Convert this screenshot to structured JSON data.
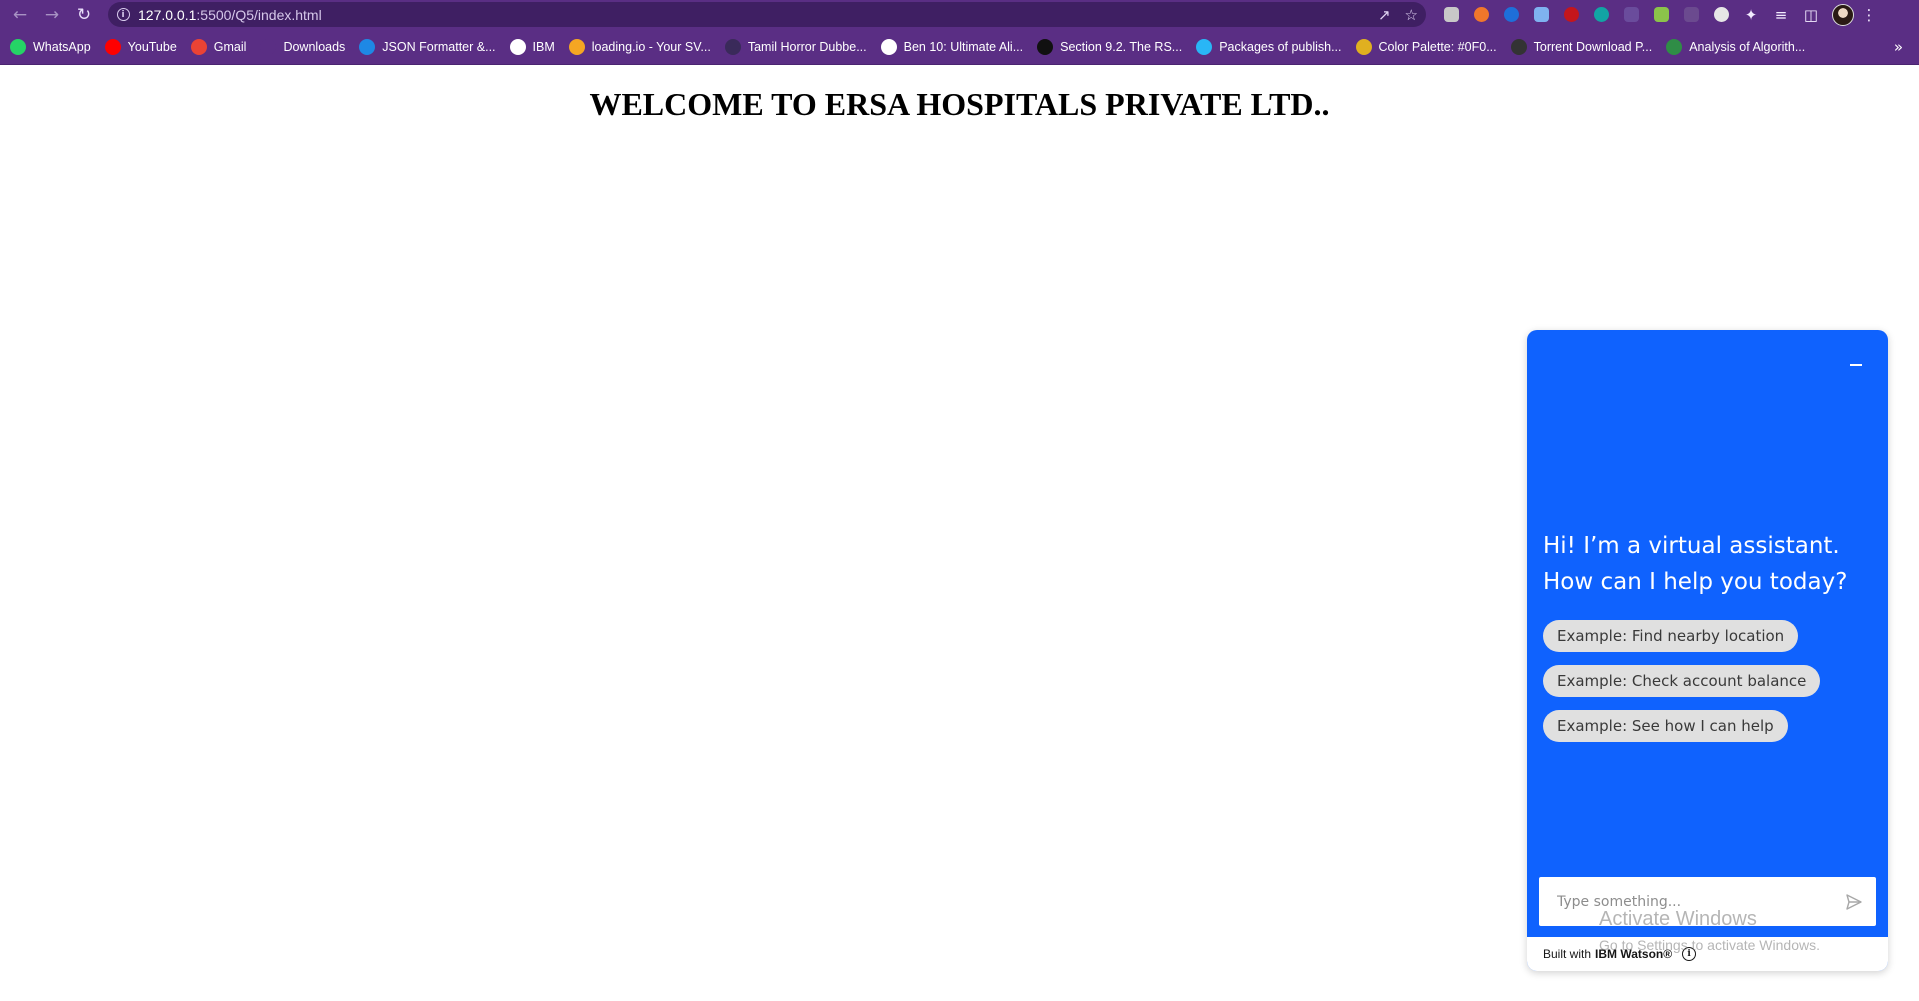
{
  "browser": {
    "url_host": "127.0.0.1",
    "url_path": ":5500/Q5/index.html",
    "bookmarks": [
      {
        "label": "WhatsApp",
        "icon": "whatsapp-icon",
        "color": "#25d366"
      },
      {
        "label": "YouTube",
        "icon": "youtube-icon",
        "color": "#ff0000"
      },
      {
        "label": "Gmail",
        "icon": "gmail-icon",
        "color": "#ea4335"
      },
      {
        "label": "Downloads",
        "icon": "download-icon",
        "color": "#5a2e84"
      },
      {
        "label": "JSON Formatter &...",
        "icon": "check-icon",
        "color": "#1e88e5"
      },
      {
        "label": "IBM",
        "icon": "globe-icon",
        "color": "#ffffff"
      },
      {
        "label": "loading.io - Your SV...",
        "icon": "loading-icon",
        "color": "#f5a623"
      },
      {
        "label": "Tamil Horror Dubbe...",
        "icon": "mask-icon",
        "color": "#3a2a5a"
      },
      {
        "label": "Ben 10: Ultimate Ali...",
        "icon": "globe-icon",
        "color": "#ffffff"
      },
      {
        "label": "Section 9.2. The RS...",
        "icon": "s-icon",
        "color": "#111111"
      },
      {
        "label": "Packages of publish...",
        "icon": "dart-icon",
        "color": "#29b6f6"
      },
      {
        "label": "Color Palette: #0F0...",
        "icon": "palette-icon",
        "color": "#e0b020"
      },
      {
        "label": "Torrent Download P...",
        "icon": "torrent-icon",
        "color": "#333333"
      },
      {
        "label": "Analysis of Algorith...",
        "icon": "gfg-icon",
        "color": "#2f8d46"
      }
    ],
    "more_glyph": "»"
  },
  "page": {
    "title": "WELCOME TO ERSA HOSPITALS PRIVATE LTD.."
  },
  "chat": {
    "greeting": "Hi! I’m a virtual assistant. How can I help you today?",
    "chips": [
      "Example: Find nearby location",
      "Example: Check account balance",
      "Example: See how I can help"
    ],
    "input_placeholder": "Type something...",
    "footer_prefix": "Built with",
    "footer_brand": "IBM Watson®",
    "accent_color": "#0f62fe"
  },
  "watermark": {
    "line1": "Activate Windows",
    "line2": "Go to Settings to activate Windows."
  }
}
